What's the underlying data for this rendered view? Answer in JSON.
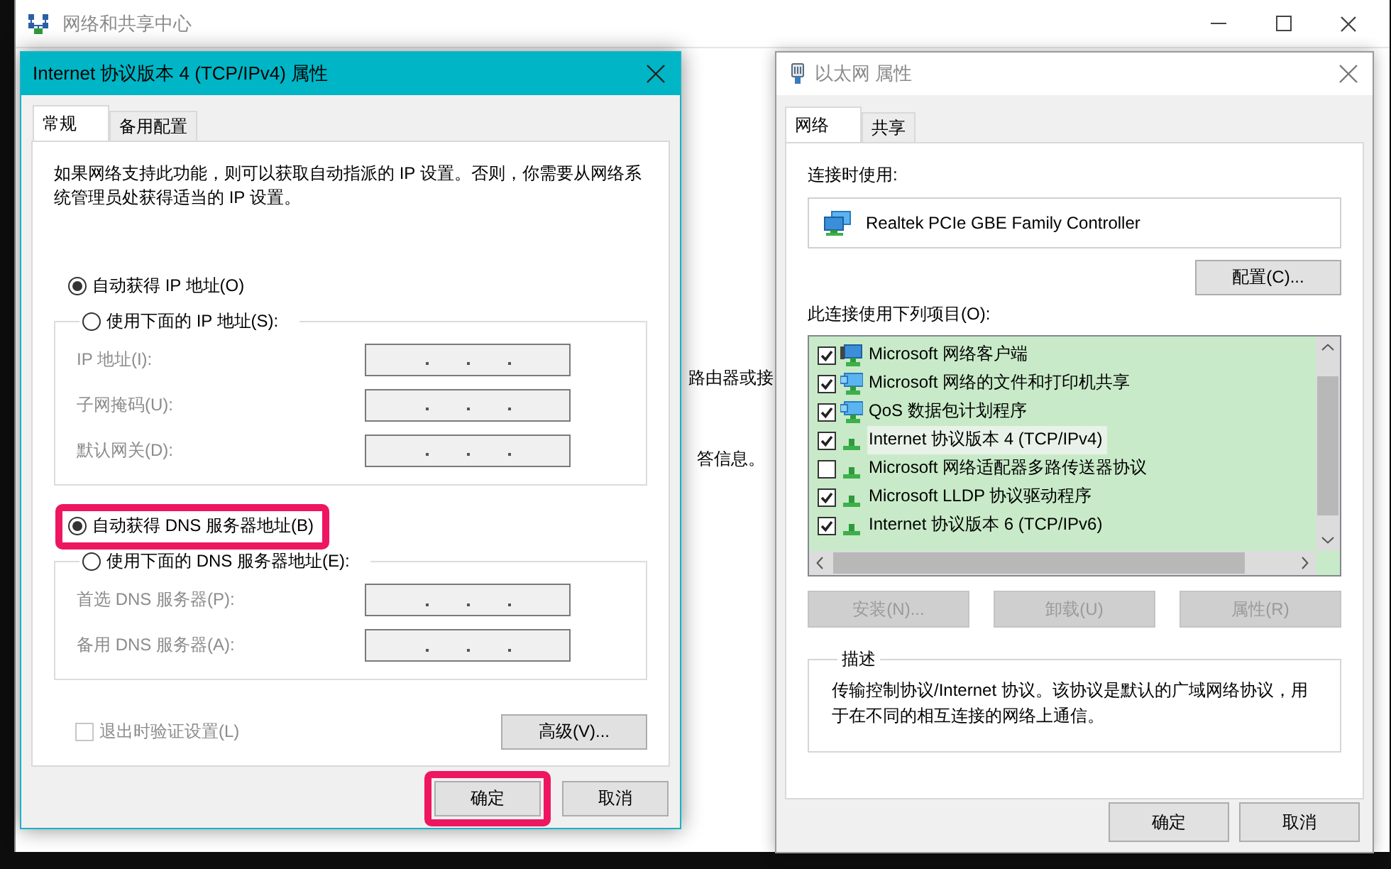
{
  "background_window": {
    "title": "网络和共享中心",
    "text_fragments": [
      "路由器或接",
      "答信息。"
    ]
  },
  "ipv4_dialog": {
    "title": "Internet 协议版本 4 (TCP/IPv4) 属性",
    "active": true,
    "tabs": [
      {
        "label": "常规",
        "selected": true
      },
      {
        "label": "备用配置",
        "selected": false
      }
    ],
    "intro": "如果网络支持此功能，则可以获取自动指派的 IP 设置。否则，你需要从网络系统管理员处获得适当的 IP 设置。",
    "ip_options": [
      {
        "label": "自动获得 IP 地址(O)",
        "selected": true,
        "highlighted": false
      },
      {
        "label": "使用下面的 IP 地址(S):",
        "selected": false,
        "highlighted": false
      }
    ],
    "ip_fields": [
      {
        "label": "IP 地址(I):",
        "disabled": true
      },
      {
        "label": "子网掩码(U):",
        "disabled": true
      },
      {
        "label": "默认网关(D):",
        "disabled": true
      }
    ],
    "dns_options": [
      {
        "label": "自动获得 DNS 服务器地址(B)",
        "selected": true,
        "highlighted": true
      },
      {
        "label": "使用下面的 DNS 服务器地址(E):",
        "selected": false,
        "highlighted": false
      }
    ],
    "dns_fields": [
      {
        "label": "首选 DNS 服务器(P):",
        "disabled": true
      },
      {
        "label": "备用 DNS 服务器(A):",
        "disabled": true
      }
    ],
    "validate_on_exit": {
      "label": "退出时验证设置(L)",
      "checked": false,
      "disabled": true
    },
    "advanced_button": "高级(V)...",
    "buttons": [
      {
        "label": "确定",
        "highlighted": true
      },
      {
        "label": "取消",
        "highlighted": false
      }
    ]
  },
  "ethernet_dialog": {
    "title": "以太网 属性",
    "active": false,
    "tabs": [
      {
        "label": "网络",
        "selected": true
      },
      {
        "label": "共享",
        "selected": false
      }
    ],
    "connect_using_label": "连接时使用:",
    "adapter": "Realtek PCIe GBE Family Controller",
    "configure_button": "配置(C)...",
    "items_label": "此连接使用下列项目(O):",
    "items": [
      {
        "label": "Microsoft 网络客户端",
        "checked": true,
        "selected": false,
        "kind": "client"
      },
      {
        "label": "Microsoft 网络的文件和打印机共享",
        "checked": true,
        "selected": false,
        "kind": "service"
      },
      {
        "label": "QoS 数据包计划程序",
        "checked": true,
        "selected": false,
        "kind": "service"
      },
      {
        "label": "Internet 协议版本 4 (TCP/IPv4)",
        "checked": true,
        "selected": true,
        "kind": "protocol"
      },
      {
        "label": "Microsoft 网络适配器多路传送器协议",
        "checked": false,
        "selected": false,
        "kind": "protocol"
      },
      {
        "label": "Microsoft LLDP 协议驱动程序",
        "checked": true,
        "selected": false,
        "kind": "protocol"
      },
      {
        "label": "Internet 协议版本 6 (TCP/IPv6)",
        "checked": true,
        "selected": false,
        "kind": "protocol"
      }
    ],
    "item_buttons": [
      {
        "label": "安装(N)...",
        "disabled": true
      },
      {
        "label": "卸载(U)",
        "disabled": true
      },
      {
        "label": "属性(R)",
        "disabled": true
      }
    ],
    "description_label": "描述",
    "description": "传输控制协议/Internet 协议。该协议是默认的广域网络协议，用于在不同的相互连接的网络上通信。",
    "buttons": [
      {
        "label": "确定"
      },
      {
        "label": "取消"
      }
    ]
  }
}
